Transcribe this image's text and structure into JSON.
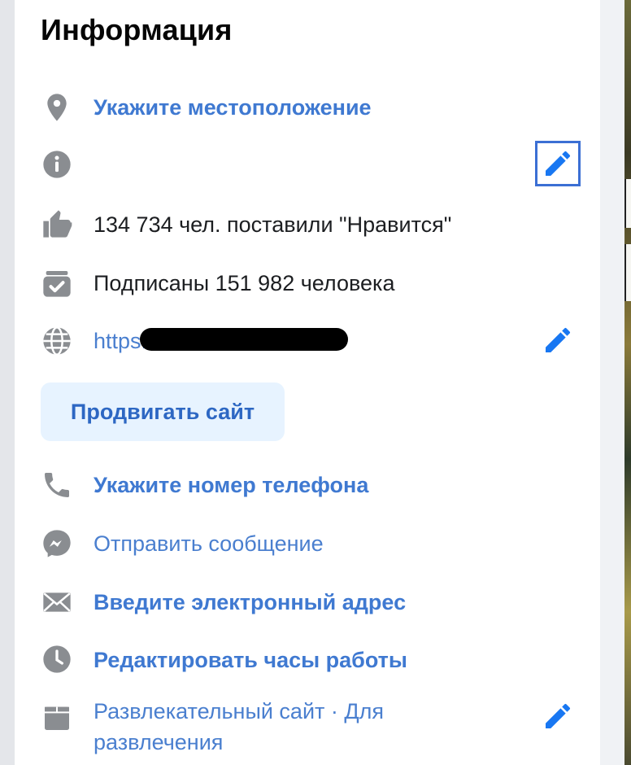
{
  "section": {
    "title": "Информация"
  },
  "rows": {
    "location": {
      "text": "Укажите местоположение",
      "icon": "location-pin-icon"
    },
    "info": {
      "text": "",
      "icon": "info-icon"
    },
    "likes": {
      "text": "134 734 чел. поставили \"Нравится\"",
      "icon": "thumbs-up-icon"
    },
    "followers": {
      "text": "Подписаны 151 982 человека",
      "icon": "followers-icon"
    },
    "website": {
      "text": "https:/",
      "icon": "globe-icon"
    },
    "phone": {
      "text": "Укажите номер телефона",
      "icon": "phone-icon"
    },
    "messenger": {
      "text": "Отправить сообщение",
      "icon": "messenger-icon"
    },
    "email": {
      "text": "Введите электронный адрес",
      "icon": "envelope-icon"
    },
    "hours": {
      "text": "Редактировать часы работы",
      "icon": "clock-icon"
    },
    "category": {
      "text": "Развлекательный сайт · Для развлечения",
      "icon": "category-icon"
    }
  },
  "buttons": {
    "promote_site": "Продвигать сайт"
  },
  "colors": {
    "link_blue": "#4a7fcf",
    "icon_gray": "#8a8d91",
    "accent": "#1877f2",
    "promote_bg": "#e7f3ff"
  }
}
